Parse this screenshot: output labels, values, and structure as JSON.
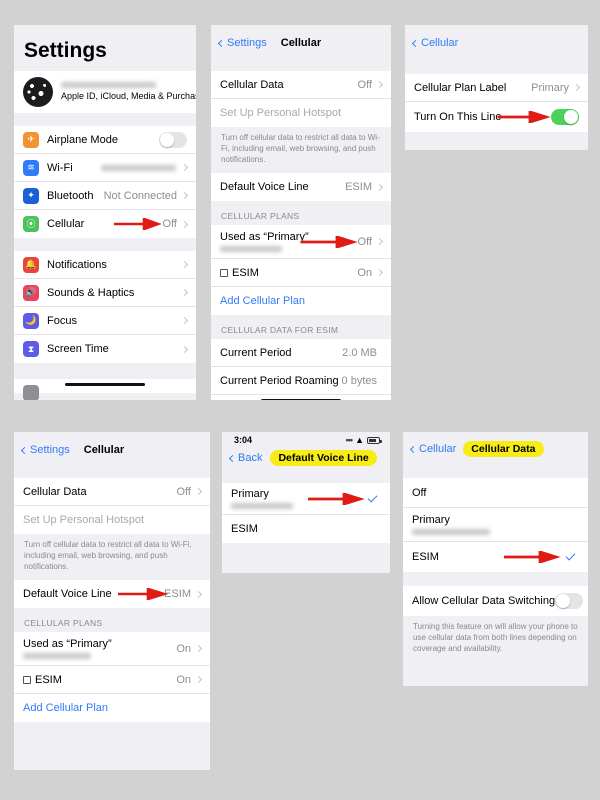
{
  "colors": {
    "accent_blue": "#2f7cf6",
    "toggle_green": "#4cd15a",
    "highlight_yellow": "#f7ec16",
    "arrow_red": "#e01b14",
    "page_background": "#d2d2d2",
    "group_background": "#efeff4"
  },
  "panel1": {
    "title": "Settings",
    "account": {
      "subtitle": "Apple ID, iCloud, Media & Purchases",
      "name_redacted": true
    },
    "rows": [
      {
        "label": "Airplane Mode",
        "value": "",
        "icon": "airplane-icon",
        "icon_color": "#f09330",
        "control": "toggle-off"
      },
      {
        "label": "Wi-Fi",
        "value": "",
        "icon": "wifi-icon",
        "icon_color": "#2f7cf6",
        "control": "chevron",
        "value_redacted": true
      },
      {
        "label": "Bluetooth",
        "value": "Not Connected",
        "icon": "bluetooth-icon",
        "icon_color": "#1c5fd6",
        "control": "chevron"
      },
      {
        "label": "Cellular",
        "value": "Off",
        "icon": "cellular-icon",
        "icon_color": "#4cc25a",
        "control": "chevron",
        "annotated": true
      }
    ],
    "rows2": [
      {
        "label": "Notifications",
        "value": "",
        "icon": "notifications-icon",
        "icon_color": "#e8453c",
        "control": "chevron"
      },
      {
        "label": "Sounds & Haptics",
        "value": "",
        "icon": "sounds-icon",
        "icon_color": "#e8445c",
        "control": "chevron"
      },
      {
        "label": "Focus",
        "value": "",
        "icon": "focus-icon",
        "icon_color": "#5e5ce6",
        "control": "chevron"
      },
      {
        "label": "Screen Time",
        "value": "",
        "icon": "screen-time-icon",
        "icon_color": "#5e5ce6",
        "control": "chevron"
      }
    ]
  },
  "panel2": {
    "back_label": "Settings",
    "title": "Cellular",
    "rows_top": [
      {
        "label": "Cellular Data",
        "value": "Off",
        "control": "chevron"
      },
      {
        "label": "Set Up Personal Hotspot",
        "value": "",
        "control": "none",
        "dim": true
      }
    ],
    "footnote": "Turn off cellular data to restrict all data to Wi-Fi, including email, web browsing, and push notifications.",
    "voice_row": {
      "label": "Default Voice Line",
      "value": "ESIM",
      "control": "chevron"
    },
    "plans_header": "CELLULAR PLANS",
    "plans": [
      {
        "label": "Used as “Primary”",
        "value": "Off",
        "control": "chevron",
        "redacted_sub": true,
        "annotated": true
      },
      {
        "label": "ESIM",
        "value": "On",
        "control": "chevron",
        "sim_icon": true
      }
    ],
    "add_plan": "Add Cellular Plan",
    "data_header": "CELLULAR DATA FOR ESIM",
    "data_rows": [
      {
        "label": "Current Period",
        "value": "2.0 MB"
      },
      {
        "label": "Current Period Roaming",
        "value": "0 bytes"
      }
    ]
  },
  "panel3": {
    "back_label": "Cellular",
    "rows": [
      {
        "label": "Cellular Plan Label",
        "value": "Primary",
        "control": "chevron"
      },
      {
        "label": "Turn On This Line",
        "value": "",
        "control": "toggle-on",
        "annotated": true
      }
    ]
  },
  "panel4": {
    "back_label": "Settings",
    "title": "Cellular",
    "rows_top": [
      {
        "label": "Cellular Data",
        "value": "Off",
        "control": "chevron"
      },
      {
        "label": "Set Up Personal Hotspot",
        "value": "",
        "control": "none",
        "dim": true
      }
    ],
    "footnote": "Turn off cellular data to restrict all data to Wi-Fi, including email, web browsing, and push notifications.",
    "voice_row": {
      "label": "Default Voice Line",
      "value": "ESIM",
      "control": "chevron",
      "annotated": true
    },
    "plans_header": "CELLULAR PLANS",
    "plans": [
      {
        "label": "Used as “Primary”",
        "value": "On",
        "control": "chevron",
        "redacted_sub": true
      },
      {
        "label": "ESIM",
        "value": "On",
        "control": "chevron",
        "sim_icon": true
      }
    ],
    "add_plan": "Add Cellular Plan"
  },
  "panel5": {
    "status": {
      "time": "3:04",
      "battery": "battery-icon",
      "wifi": "wifi-icon",
      "cellular": "signal-icon"
    },
    "back_label": "Back",
    "title": "Default Voice Line",
    "title_highlighted": true,
    "rows": [
      {
        "label": "Primary",
        "checked": true,
        "redacted_sub": true,
        "annotated": true
      },
      {
        "label": "ESIM",
        "checked": false
      }
    ]
  },
  "panel6": {
    "back_label": "Cellular",
    "title": "Cellular Data",
    "title_highlighted": true,
    "rows": [
      {
        "label": "Off",
        "checked": false
      },
      {
        "label": "Primary",
        "checked": false,
        "redacted_sub": true
      },
      {
        "label": "ESIM",
        "checked": true,
        "annotated": true
      }
    ],
    "switching_row": {
      "label": "Allow Cellular Data Switching",
      "control": "toggle-off"
    },
    "footnote": "Turning this feature on will allow your phone to use cellular data from both lines depending on coverage and availability."
  }
}
